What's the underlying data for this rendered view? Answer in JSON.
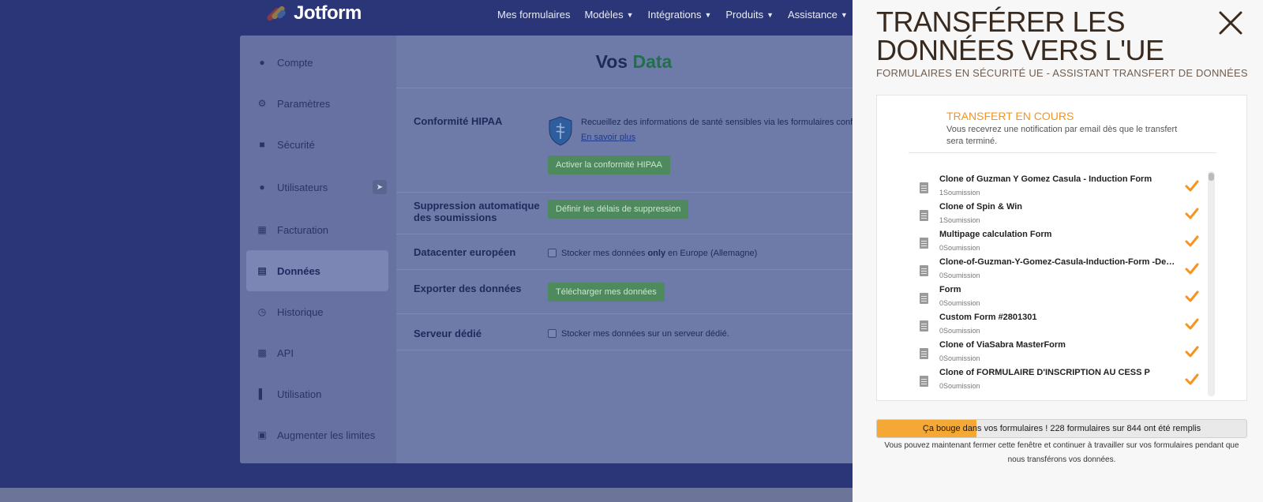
{
  "app": {
    "logo_text": "Jotform",
    "nav": [
      "Mes formulaires",
      "Modèles",
      "Intégrations",
      "Produits",
      "Assistance"
    ],
    "colors": {
      "logo_red": "#f14c2a",
      "logo_orange": "#ffb629",
      "logo_blue": "#0a9fff"
    }
  },
  "sidebar": {
    "items": [
      {
        "label": "Compte",
        "icon": "user-icon"
      },
      {
        "label": "Paramètres",
        "icon": "gear-icon"
      },
      {
        "label": "Sécurité",
        "icon": "lock-icon"
      },
      {
        "label": "Utilisateurs",
        "icon": "users-icon",
        "badge": "rocket-icon"
      },
      {
        "label": "Facturation",
        "icon": "invoice-icon"
      },
      {
        "label": "Données",
        "icon": "database-icon",
        "active": true
      },
      {
        "label": "Historique",
        "icon": "history-icon"
      },
      {
        "label": "API",
        "icon": "api-icon"
      },
      {
        "label": "Utilisation",
        "icon": "bar-chart-icon"
      },
      {
        "label": "Augmenter les limites",
        "icon": "gift-icon"
      }
    ]
  },
  "content": {
    "title_prefix": "Vos",
    "title_accent": "Data",
    "hipaa": {
      "label": "Conformité HIPAA",
      "text": "Recueillez des informations de santé sensibles via les formulaires conf",
      "link": "En savoir plus",
      "button": "Activer la conformité HIPAA"
    },
    "deletion": {
      "label": "Suppression automatique des soumissions",
      "button": "Définir les délais de suppression"
    },
    "datacenter": {
      "label": "Datacenter européen",
      "text_a": "Stocker mes données",
      "text_b": "only",
      "text_c": "en Europe (Allemagne)"
    },
    "export": {
      "label": "Exporter des données",
      "button": "Télécharger mes données"
    },
    "dedicated": {
      "label": "Serveur dédié",
      "text": "Stocker mes données sur un serveur dédié."
    }
  },
  "modal": {
    "title": "TRANSFÉRER LES DONNÉES VERS L'UE",
    "subtitle": "FORMULAIRES EN SÉCURITÉ UE - ASSISTANT TRANSFERT DE DONNÉES",
    "status_title": "TRANSFERT EN COURS",
    "status_text": "Vous recevrez une notification par email dès que le transfert sera terminé.",
    "forms": [
      {
        "name": "Clone of Guzman Y Gomez Casula - Induction Form",
        "count": "1",
        "unit": "Soumission"
      },
      {
        "name": "Clone of Spin & Win",
        "count": "1",
        "unit": "Soumission"
      },
      {
        "name": "Multipage calculation Form",
        "count": "0",
        "unit": "Soumission"
      },
      {
        "name": "Clone-of-Guzman-Y-Gomez-Casula-Induction-Form -Den...",
        "count": "0",
        "unit": "Soumission"
      },
      {
        "name": "Form",
        "count": "0",
        "unit": "Soumission"
      },
      {
        "name": "Custom Form #2801301",
        "count": "0",
        "unit": "Soumission"
      },
      {
        "name": "Clone of ViaSabra MasterForm",
        "count": "0",
        "unit": "Soumission"
      },
      {
        "name": "Clone of FORMULAIRE D'INSCRIPTION AU CESS P",
        "count": "0",
        "unit": "Soumission"
      }
    ],
    "progress_text": "Ça bouge dans vos formulaires ! 228 formulaires sur 844 ont été remplis",
    "progress_done": 228,
    "progress_total": 844,
    "note": "Vous pouvez maintenant fermer cette fenêtre et continuer à travailler sur vos formulaires pendant que nous transférons vos données.",
    "colors": {
      "accent": "#f5941e",
      "check": "#f5941e"
    }
  }
}
